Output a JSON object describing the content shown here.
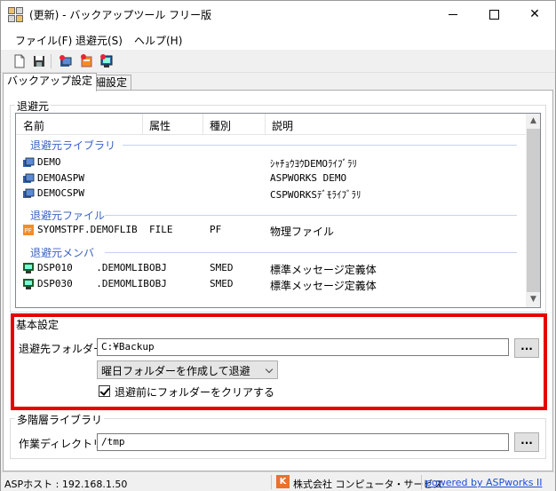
{
  "window": {
    "title": "(更新) - バックアップツール フリー版",
    "min_label": "",
    "max_label": "",
    "close_label": "✕"
  },
  "menu": [
    "ファイル(F)",
    "退避元(S)",
    "ヘルプ(H)"
  ],
  "tabs": [
    "バックアップ設定",
    "詳細設定"
  ],
  "source": {
    "label": "退避元",
    "columns": [
      "名前",
      "属性",
      "種別",
      "説明"
    ],
    "groups": [
      {
        "name": "退避元ライブラリ",
        "rows": [
          {
            "name": "DEMO",
            "attr": "",
            "type": "",
            "desc": "ｼｬﾁｮｳﾖｳDEMOﾗｲﾌﾞﾗﾘ"
          },
          {
            "name": "DEMOASPW",
            "attr": "",
            "type": "",
            "desc": "ASPWORKS DEMO"
          },
          {
            "name": "DEMOCSPW",
            "attr": "",
            "type": "",
            "desc": "CSPWORKSﾃﾞﾓﾗｲﾌﾞﾗﾘ"
          }
        ]
      },
      {
        "name": "退避元ファイル",
        "rows": [
          {
            "name": "SYOMSTPF.DEMOFLIB",
            "attr": "FILE",
            "type": "PF",
            "desc": "物理ファイル"
          }
        ]
      },
      {
        "name": "退避元メンバ",
        "rows": [
          {
            "name": "DSP010    .DEMOMLIB",
            "attr": "OBJ",
            "type": "SMED",
            "desc": "標準メッセージ定義体"
          },
          {
            "name": "DSP030    .DEMOMLIB",
            "attr": "OBJ",
            "type": "SMED",
            "desc": "標準メッセージ定義体"
          }
        ]
      }
    ]
  },
  "basic": {
    "label": "基本設定",
    "dest_label": "退避先フォルダー",
    "dest_value": "C:¥Backup",
    "browse_label": "...",
    "weekday_option": "曜日フォルダーを作成して退避",
    "clear_label": "退避前にフォルダーをクリアする",
    "clear_checked": true
  },
  "multilevel": {
    "label": "多階層ライブラリ",
    "workdir_label": "作業ディレクトリ",
    "workdir_value": "/tmp",
    "browse_label": "..."
  },
  "status": {
    "host": "ASPホスト : 192.168.1.50",
    "company": "株式会社 コンピュータ・サービス",
    "logo_letter": "K",
    "link": "powered by ASPworks II"
  },
  "colors": {
    "group_header": "#3b62c4",
    "highlight": "#e60000",
    "link": "#1a4fd6"
  }
}
